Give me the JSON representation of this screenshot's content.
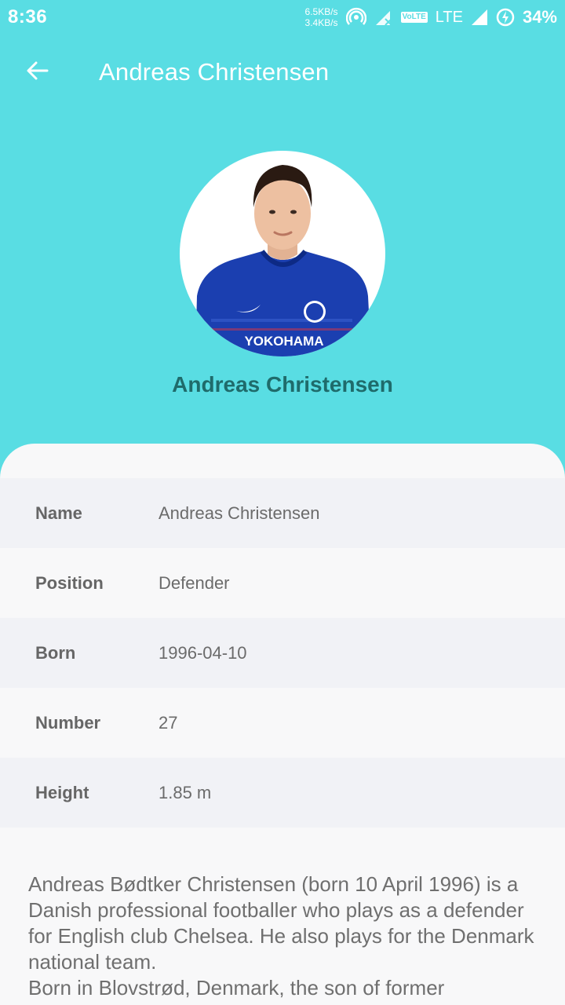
{
  "status_bar": {
    "time": "8:36",
    "net_up": "6.5KB/s",
    "net_down": "3.4KB/s",
    "volte": "VoLTE",
    "network": "LTE",
    "battery": "34%"
  },
  "app_bar": {
    "back_icon": "arrow-left-icon",
    "title": "Andreas Christensen"
  },
  "profile": {
    "name": "Andreas Christensen",
    "photo_alt": "player-photo",
    "jersey_sponsor": "YOKOHAMA"
  },
  "details": [
    {
      "label": "Name",
      "value": "Andreas Christensen"
    },
    {
      "label": "Position",
      "value": "Defender"
    },
    {
      "label": "Born",
      "value": "1996-04-10"
    },
    {
      "label": "Number",
      "value": "27"
    },
    {
      "label": "Height",
      "value": "1.85 m"
    }
  ],
  "bio": {
    "paragraph1": "Andreas Bødtker Christensen (born 10 April 1996) is a Danish professional footballer who plays as a defender for English club Chelsea. He also plays for the Denmark national team.",
    "paragraph2": "Born in Blovstrød, Denmark, the son of former"
  },
  "colors": {
    "header_bg": "#59dde3",
    "name_color": "#1f6b6b",
    "card_bg": "#f8f8f9",
    "row_alt_bg": "#f1f2f6"
  }
}
